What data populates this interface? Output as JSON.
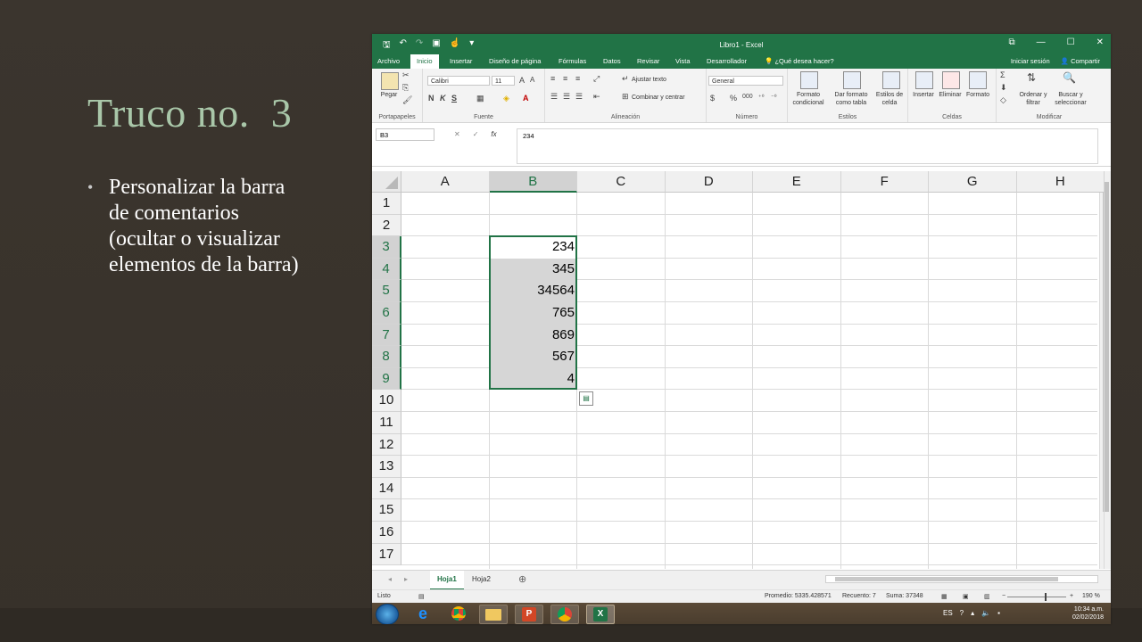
{
  "slide": {
    "title": "Truco no.  3",
    "bullet": "Personalizar la barra de comentarios (ocultar o visualizar elementos de la barra)"
  },
  "excel": {
    "title": "Libro1 - Excel",
    "menu_tabs": [
      "Archivo",
      "Inicio",
      "Insertar",
      "Diseño de página",
      "Fórmulas",
      "Datos",
      "Revisar",
      "Vista",
      "Desarrollador"
    ],
    "active_tab": "Inicio",
    "tell_me": "¿Qué desea hacer?",
    "sign_in": "Iniciar sesión",
    "share": "Compartir",
    "ribbon": {
      "clipboard": {
        "paste": "Pegar",
        "label": "Portapapeles"
      },
      "font": {
        "name": "Calibri",
        "size": "11",
        "label": "Fuente"
      },
      "alignment": {
        "wrap": "Ajustar texto",
        "merge": "Combinar y centrar",
        "label": "Alineación"
      },
      "number": {
        "format": "General",
        "label": "Número"
      },
      "styles": {
        "conditional": "Formato condicional",
        "table": "Dar formato como tabla",
        "cell": "Estilos de celda",
        "label": "Estilos"
      },
      "cells": {
        "insert": "Insertar",
        "delete": "Eliminar",
        "format": "Formato",
        "label": "Celdas"
      },
      "editing": {
        "sort": "Ordenar y filtrar",
        "find": "Buscar y seleccionar",
        "label": "Modificar"
      }
    },
    "name_box": "B3",
    "formula": "234",
    "columns": [
      "A",
      "B",
      "C",
      "D",
      "E",
      "F",
      "G",
      "H"
    ],
    "selected_column": "B",
    "rows": [
      "1",
      "2",
      "3",
      "4",
      "5",
      "6",
      "7",
      "8",
      "9",
      "10",
      "11",
      "12",
      "13",
      "14",
      "15",
      "16",
      "17"
    ],
    "selected_rows": [
      "3",
      "4",
      "5",
      "6",
      "7",
      "8",
      "9"
    ],
    "cells_b": [
      "234",
      "345",
      "34564",
      "765",
      "869",
      "567",
      "4"
    ],
    "sheets": [
      "Hoja1",
      "Hoja2"
    ],
    "active_sheet": "Hoja1",
    "status": {
      "ready": "Listo",
      "average": "Promedio: 5335.428571",
      "count": "Recuento: 7",
      "sum": "Suma: 37348",
      "zoom": "190 %"
    }
  },
  "taskbar": {
    "lang": "ES",
    "time": "10:34 a.m.",
    "date": "02/02/2018"
  },
  "colors": {
    "excel_green": "#217346",
    "title_green": "#a9c7a9"
  }
}
